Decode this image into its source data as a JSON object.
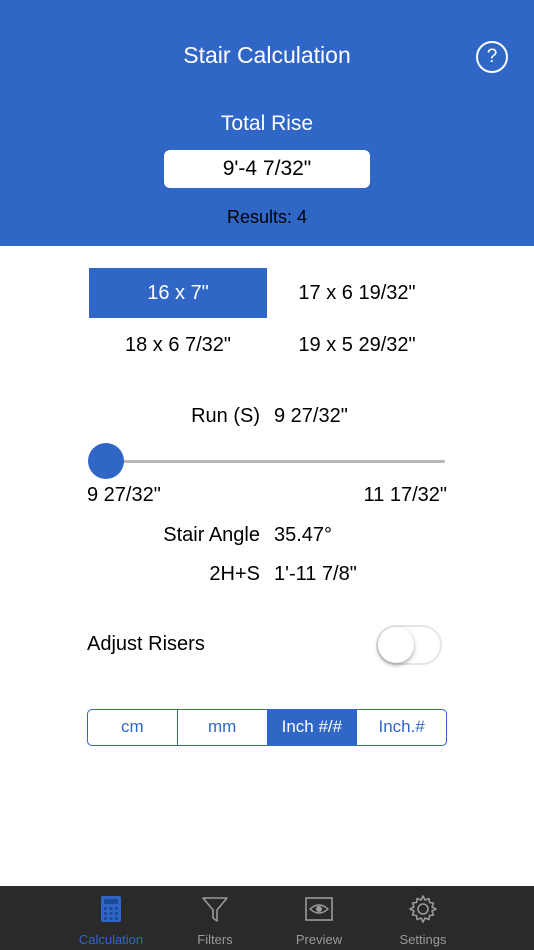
{
  "header": {
    "title": "Stair Calculation",
    "help_label": "?",
    "total_rise_label": "Total Rise",
    "total_rise_value": "9'-4 7/32\"",
    "results_text": "Results: 4"
  },
  "options": [
    {
      "label": "16 x 7\"",
      "selected": true
    },
    {
      "label": "17 x 6 19/32\"",
      "selected": false
    },
    {
      "label": "18 x 6 7/32\"",
      "selected": false
    },
    {
      "label": "19 x 5 29/32\"",
      "selected": false
    }
  ],
  "run": {
    "label": "Run (S)",
    "value": "9 27/32\"",
    "slider_min": "9 27/32\"",
    "slider_max": "11 17/32\"",
    "slider_position": 0
  },
  "stair_angle": {
    "label": "Stair Angle",
    "value": "35.47°"
  },
  "two_h_s": {
    "label": "2H+S",
    "value": "1'-11 7/8\""
  },
  "adjust_risers": {
    "label": "Adjust Risers",
    "on": false
  },
  "units": {
    "items": [
      "cm",
      "mm",
      "Inch #/#",
      "Inch.#"
    ],
    "selected": "Inch #/#"
  },
  "tabbar": {
    "items": [
      {
        "label": "Calculation",
        "icon": "calculator-icon",
        "active": true
      },
      {
        "label": "Filters",
        "icon": "funnel-icon",
        "active": false
      },
      {
        "label": "Preview",
        "icon": "eye-icon",
        "active": false
      },
      {
        "label": "Settings",
        "icon": "gear-icon",
        "active": false
      }
    ]
  },
  "colors": {
    "accent": "#3067c7",
    "tabbar_bg": "#2a2a2a",
    "tab_inactive": "#9a9a9a"
  }
}
